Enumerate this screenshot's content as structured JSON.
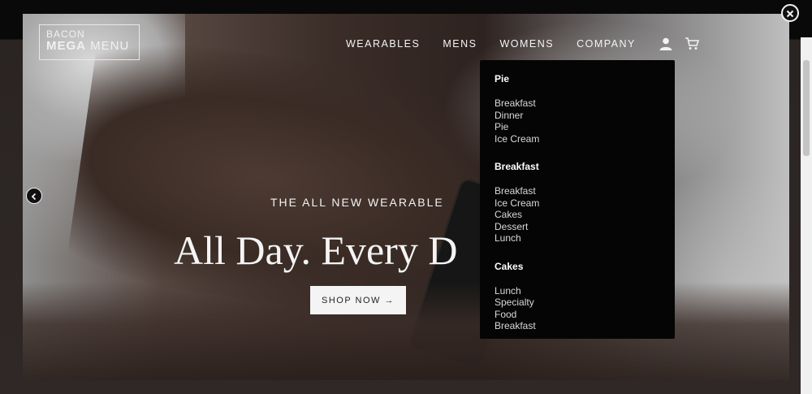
{
  "logo": {
    "line1": "BACON",
    "line2_bold": "MEGA",
    "line2_rest": "MENU"
  },
  "nav": {
    "items": [
      {
        "label": "WEARABLES"
      },
      {
        "label": "MENS"
      },
      {
        "label": "WOMENS"
      },
      {
        "label": "COMPANY"
      }
    ],
    "icons": [
      "user-icon",
      "cart-icon"
    ]
  },
  "dropdown": {
    "sections": [
      {
        "title": "Pie",
        "items": [
          "Breakfast",
          "Dinner",
          "Pie",
          "Ice Cream"
        ]
      },
      {
        "title": "Breakfast",
        "items": [
          "Breakfast",
          "Ice Cream",
          "Cakes",
          "Dessert",
          "Lunch"
        ]
      },
      {
        "title": "Cakes",
        "items": [
          "Lunch",
          "Specialty",
          "Food",
          "Breakfast"
        ]
      }
    ]
  },
  "hero": {
    "subtitle": "THE ALL NEW WEARABLE",
    "title": "All Day. Every D",
    "button_label": "SHOP NOW →"
  },
  "controls": {
    "prev_icon": "chevron-left-icon",
    "close_icon": "close-icon"
  },
  "colors": {
    "dropdown_bg": "#050505",
    "button_bg": "#f4f4f4"
  }
}
